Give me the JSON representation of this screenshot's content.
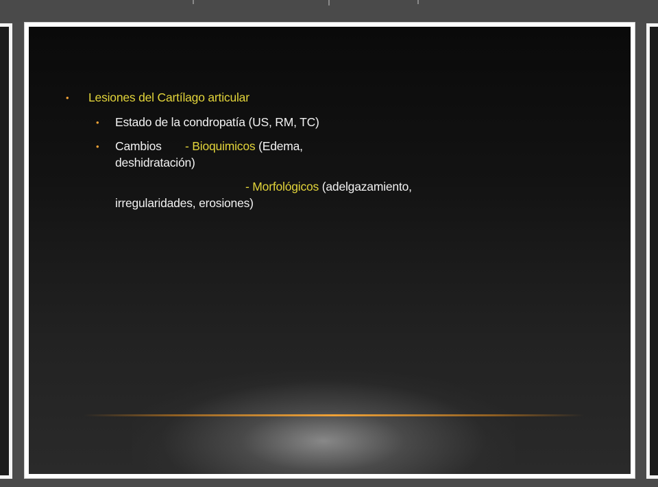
{
  "slide": {
    "bullet_glyph": "•",
    "level1": {
      "text": "Lesiones del Cartílago articular"
    },
    "level2": [
      {
        "text": "Estado de la condropatía  (US, RM, TC)"
      },
      {
        "label": "Cambios",
        "sub1_highlight": "- Bioquimicos",
        "sub1_rest": " (Edema,",
        "sub1_continuation": "deshidratación)",
        "sub2_highlight": "- Morfológicos",
        "sub2_rest": " (adelgazamiento,",
        "sub2_continuation": "irregularidades, erosiones)"
      }
    ]
  },
  "colors": {
    "accent": "#f0a236",
    "highlight": "#e2d43a",
    "text": "#f2f2f2",
    "background": "#111111"
  }
}
